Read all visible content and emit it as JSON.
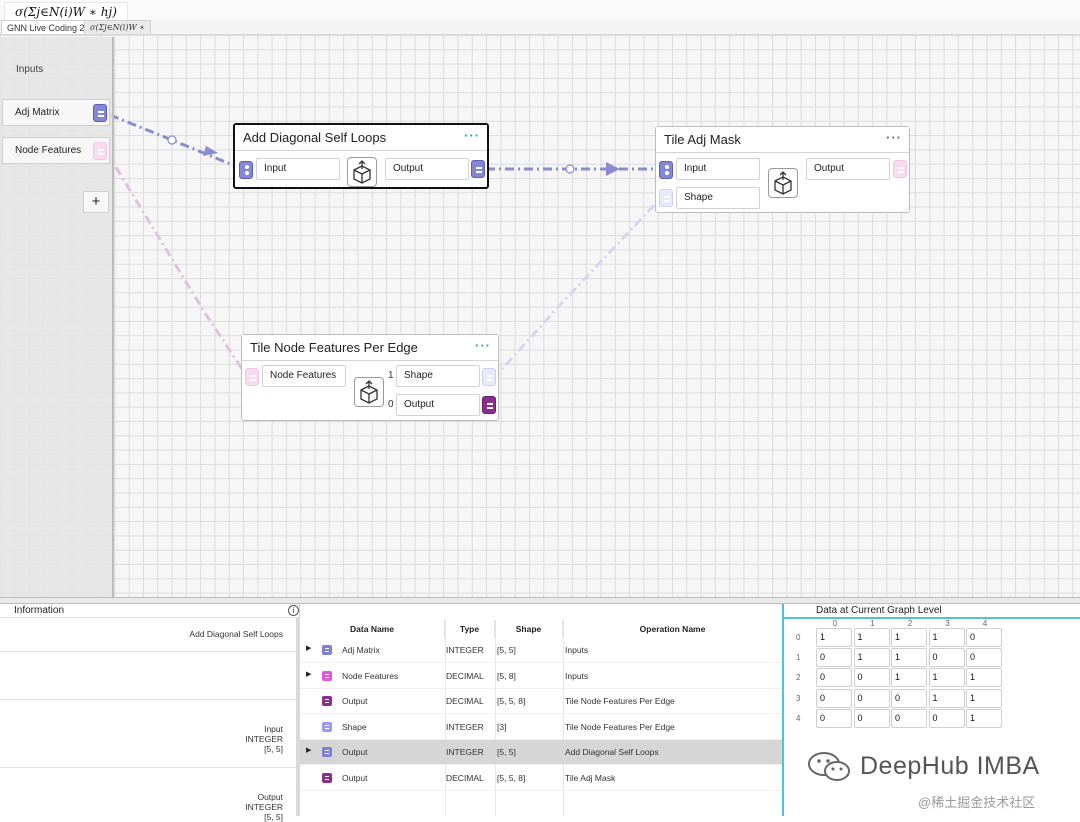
{
  "window": {
    "formula_title": "σ(Σj∈N(i)W ∗ hj)",
    "tabs": [
      {
        "label": "GNN Live Coding 2"
      },
      {
        "label": "σ(Σj∈N(i)W ∗"
      }
    ]
  },
  "inputs_panel": {
    "title": "Inputs",
    "items": [
      {
        "label": "Adj Matrix"
      },
      {
        "label": "Node Features"
      }
    ],
    "add_label": "+"
  },
  "nodes": {
    "add_diagonal": {
      "title": "Add Diagonal Self Loops",
      "menu": "···",
      "input": "Input",
      "output": "Output"
    },
    "tile_adj": {
      "title": "Tile Adj Mask",
      "menu": "···",
      "input": "Input",
      "shape": "Shape",
      "output": "Output"
    },
    "tile_node": {
      "title": "Tile Node Features Per Edge",
      "menu": "···",
      "input": "Node Features",
      "shape": "Shape",
      "output": "Output",
      "shape_index": "1",
      "output_index": "0"
    }
  },
  "info": {
    "title": "Information",
    "icon": "info-icon",
    "op_name": "Add Diagonal Self Loops",
    "input_block": [
      "Input",
      "INTEGER",
      "[5, 5]"
    ],
    "output_block": [
      "Output",
      "INTEGER",
      "[5, 5]"
    ]
  },
  "table": {
    "headers": [
      "Data Name",
      "Type",
      "Shape",
      "Operation Name"
    ],
    "rows": [
      {
        "arrow": "▶",
        "name": "Adj Matrix",
        "type": "INTEGER",
        "shape": "[5, 5]",
        "op": "Inputs",
        "chip": "#7f80d6"
      },
      {
        "arrow": "▶",
        "name": "Node Features",
        "type": "DECIMAL",
        "shape": "[5, 8]",
        "op": "Inputs",
        "chip": "#e255d6"
      },
      {
        "arrow": "",
        "name": "Output",
        "type": "DECIMAL",
        "shape": "[5, 5, 8]",
        "op": "Tile Node Features Per Edge",
        "chip": "#8b2f8d"
      },
      {
        "arrow": "",
        "name": "Shape",
        "type": "INTEGER",
        "shape": "[3]",
        "op": "Tile Node Features Per Edge",
        "chip": "#9a9bea"
      },
      {
        "arrow": "▶",
        "name": "Output",
        "type": "INTEGER",
        "shape": "[5, 5]",
        "op": "Add Diagonal Self Loops",
        "chip": "#7f80d6"
      },
      {
        "arrow": "",
        "name": "Output",
        "type": "DECIMAL",
        "shape": "[5, 5, 8]",
        "op": "Tile Adj Mask",
        "chip": "#8b2f8d"
      }
    ]
  },
  "matrix": {
    "title": "Data at Current Graph Level",
    "col_labels": [
      "0",
      "1",
      "2",
      "3",
      "4"
    ],
    "row_labels": [
      "0",
      "1",
      "2",
      "3",
      "4"
    ],
    "values": [
      [
        "1",
        "1",
        "1",
        "1",
        "0"
      ],
      [
        "0",
        "1",
        "1",
        "0",
        "0"
      ],
      [
        "0",
        "0",
        "1",
        "1",
        "1"
      ],
      [
        "0",
        "0",
        "0",
        "1",
        "1"
      ],
      [
        "0",
        "0",
        "0",
        "0",
        "1"
      ]
    ]
  },
  "watermark": {
    "text": "DeepHub IMBA",
    "sub": "@稀土掘金技术社区"
  },
  "colors": {
    "accent": "#55bfd6",
    "integer_port": "#8486d6",
    "decimal_port": "#8b2f8d",
    "menu_dots": "#1aa8b8"
  }
}
